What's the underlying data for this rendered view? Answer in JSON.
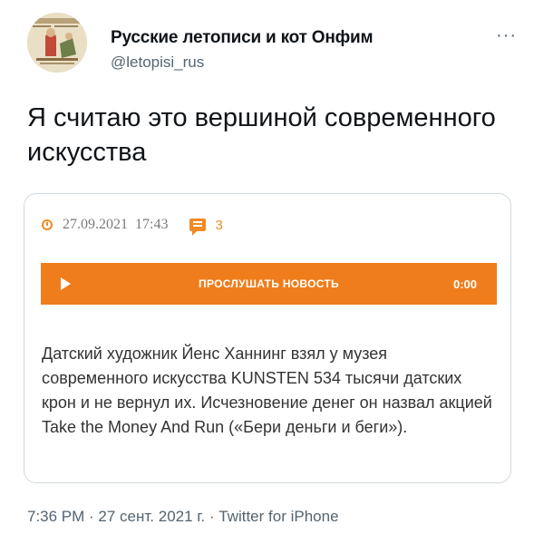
{
  "author": {
    "name": "Русские летописи и кот Онфим",
    "handle": "@letopisi_rus",
    "avatar_icon": "medieval-manuscript-avatar"
  },
  "more_icon": "more-options-icon",
  "tweet": {
    "text": "Я считаю это вершиной современного искусства"
  },
  "card": {
    "date": "27.09.2021",
    "time": "17:43",
    "comments_count": "3",
    "accent_color": "#f07d1b",
    "player": {
      "label": "ПРОСЛУШАТЬ НОВОСТЬ",
      "time": "0:00"
    },
    "article": "Датский художник Йенс Ханнинг взял у музея современного искусства KUNSTEN 534 тысячи датских крон и не вернул их. Исчезновение денег он назвал акцией Take the Money And Run («Бери деньги и беги»)."
  },
  "footer": {
    "timestamp": "7:36 PM · 27 сент. 2021 г. · Twitter for iPhone"
  }
}
